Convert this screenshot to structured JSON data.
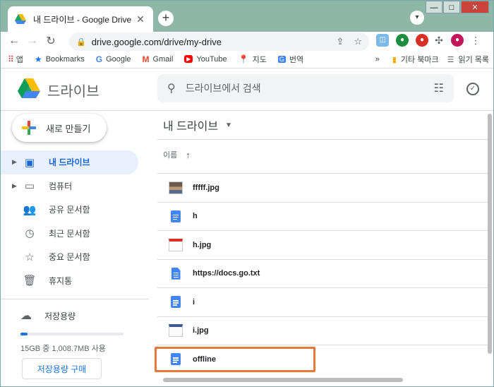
{
  "browser": {
    "tab_title": "내 드라이브 - Google Drive",
    "url": "drive.google.com/drive/my-drive"
  },
  "bookmarks": {
    "items": [
      {
        "label": "앱",
        "icon": "apps-grid-icon"
      },
      {
        "label": "Bookmarks",
        "icon": "star-icon"
      },
      {
        "label": "Google",
        "icon": "google-icon"
      },
      {
        "label": "Gmail",
        "icon": "gmail-icon"
      },
      {
        "label": "YouTube",
        "icon": "youtube-icon"
      },
      {
        "label": "지도",
        "icon": "maps-pin-icon"
      },
      {
        "label": "번역",
        "icon": "translate-icon"
      }
    ],
    "more": "»",
    "other": "기타 북마크",
    "reading_list": "읽기 목록"
  },
  "drive": {
    "app_name": "드라이브",
    "search_placeholder": "드라이브에서 검색",
    "new_button": "새로 만들기",
    "nav": [
      {
        "label": "내 드라이브",
        "icon": "my-drive-icon",
        "active": true,
        "expandable": true
      },
      {
        "label": "컴퓨터",
        "icon": "computers-icon",
        "active": false,
        "expandable": true
      },
      {
        "label": "공유 문서함",
        "icon": "shared-icon",
        "active": false,
        "expandable": false
      },
      {
        "label": "최근 문서함",
        "icon": "clock-icon",
        "active": false,
        "expandable": false
      },
      {
        "label": "중요 문서함",
        "icon": "star-icon",
        "active": false,
        "expandable": false
      },
      {
        "label": "휴지통",
        "icon": "trash-icon",
        "active": false,
        "expandable": false
      }
    ],
    "storage": {
      "label": "저장용량",
      "usage_text": "15GB 중 1,008.7MB 사용",
      "used_fraction": 0.067,
      "buy_button": "저장용량 구매"
    },
    "main": {
      "title": "내 드라이브",
      "sort_column": "이름",
      "files": [
        {
          "name": "fffff.jpg",
          "type": "image"
        },
        {
          "name": "h",
          "type": "doc"
        },
        {
          "name": "h.jpg",
          "type": "image"
        },
        {
          "name": "https://docs.go.txt",
          "type": "txt"
        },
        {
          "name": "i",
          "type": "doc"
        },
        {
          "name": "i.jpg",
          "type": "image"
        },
        {
          "name": "offline",
          "type": "doc",
          "highlighted": true
        }
      ]
    }
  },
  "colors": {
    "accent": "#1a73e8",
    "active_bg": "#e8f0fe",
    "highlight_border": "#e8793a"
  }
}
